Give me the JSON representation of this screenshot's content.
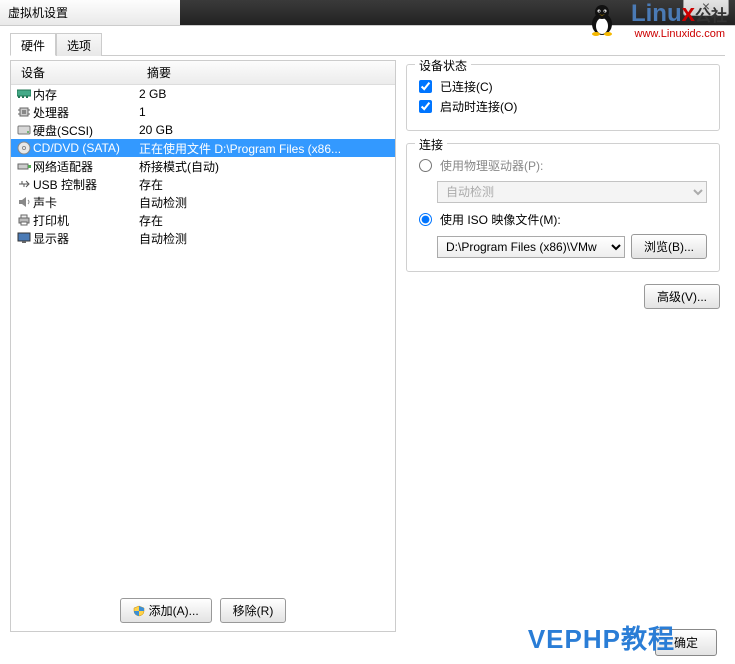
{
  "window": {
    "title": "虚拟机设置",
    "close_label": "×"
  },
  "watermark": {
    "logo_main": "Linu",
    "logo_last": "x",
    "logo_suffix": "公社",
    "url": "www.Linuxidc.com",
    "bottom": "VEPHP教程"
  },
  "tabs": {
    "hardware": "硬件",
    "options": "选项"
  },
  "columns": {
    "device": "设备",
    "summary": "摘要"
  },
  "devices": [
    {
      "id": "memory",
      "name": "内存",
      "summary": "2 GB"
    },
    {
      "id": "cpu",
      "name": "处理器",
      "summary": "1"
    },
    {
      "id": "hdd",
      "name": "硬盘(SCSI)",
      "summary": "20 GB"
    },
    {
      "id": "cddvd",
      "name": "CD/DVD (SATA)",
      "summary": "正在使用文件 D:\\Program Files (x86..."
    },
    {
      "id": "net",
      "name": "网络适配器",
      "summary": "桥接模式(自动)"
    },
    {
      "id": "usb",
      "name": "USB 控制器",
      "summary": "存在"
    },
    {
      "id": "sound",
      "name": "声卡",
      "summary": "自动检测"
    },
    {
      "id": "printer",
      "name": "打印机",
      "summary": "存在"
    },
    {
      "id": "display",
      "name": "显示器",
      "summary": "自动检测"
    }
  ],
  "buttons": {
    "add": "添加(A)...",
    "remove": "移除(R)",
    "browse": "浏览(B)...",
    "advanced": "高级(V)...",
    "ok": "确定"
  },
  "status_group": {
    "title": "设备状态",
    "connected": "已连接(C)",
    "connect_at_power": "启动时连接(O)"
  },
  "connection_group": {
    "title": "连接",
    "use_physical": "使用物理驱动器(P):",
    "auto_detect": "自动检测",
    "use_iso": "使用 ISO 映像文件(M):",
    "iso_path": "D:\\Program Files (x86)\\VMw"
  }
}
